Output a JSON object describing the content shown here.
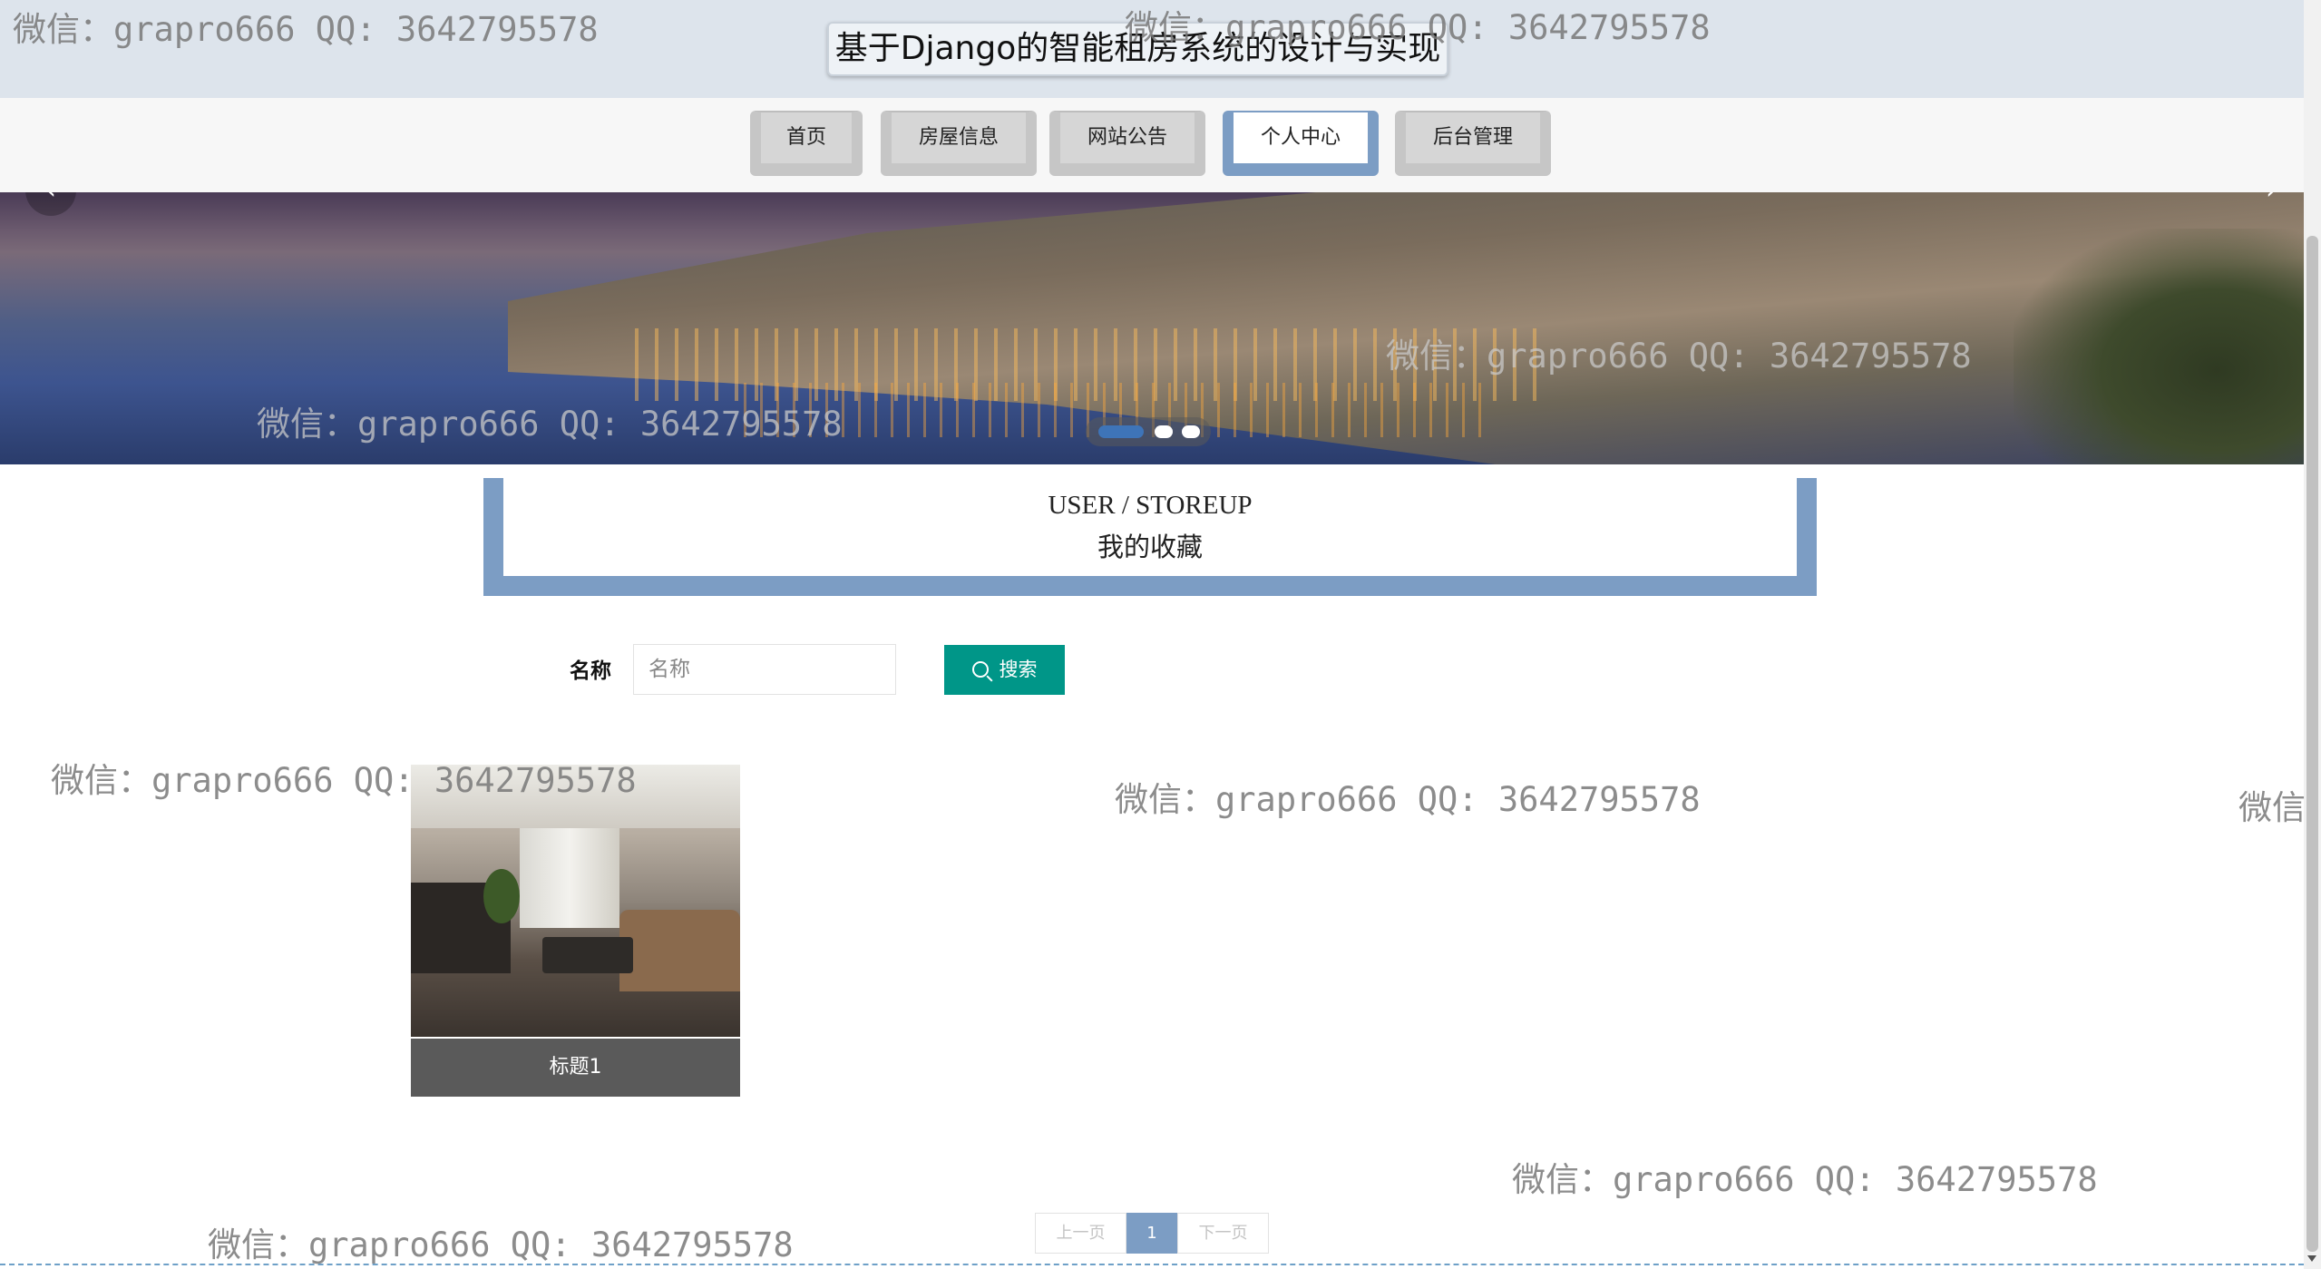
{
  "header": {
    "site_title": "基于Django的智能租房系统的设计与实现"
  },
  "nav": {
    "items": [
      {
        "label": "首页",
        "active": false
      },
      {
        "label": "房屋信息",
        "active": false
      },
      {
        "label": "网站公告",
        "active": false
      },
      {
        "label": "个人中心",
        "active": true
      },
      {
        "label": "后台管理",
        "active": false
      }
    ]
  },
  "banner": {
    "slides_count": 3,
    "active_slide": 1,
    "prev_arrow": "‹",
    "next_arrow": "›"
  },
  "section": {
    "title_en": "USER / STOREUP",
    "title_cn": "我的收藏"
  },
  "search": {
    "label": "名称",
    "placeholder": "名称",
    "value": "",
    "button_label": "搜索",
    "button_icon": "search-icon"
  },
  "favorites": [
    {
      "title": "标题1",
      "image": "living-room-photo"
    }
  ],
  "pagination": {
    "prev_label": "上一页",
    "current_page": "1",
    "next_label": "下一页"
  },
  "watermark": {
    "text": "微信：grapro666 QQ: 3642795578",
    "short_text": "微信"
  },
  "colors": {
    "accent": "#7c9dc4",
    "search_button": "#009688",
    "caption_bg": "#5a5a5a",
    "topbar_bg": "#dde4ec"
  }
}
